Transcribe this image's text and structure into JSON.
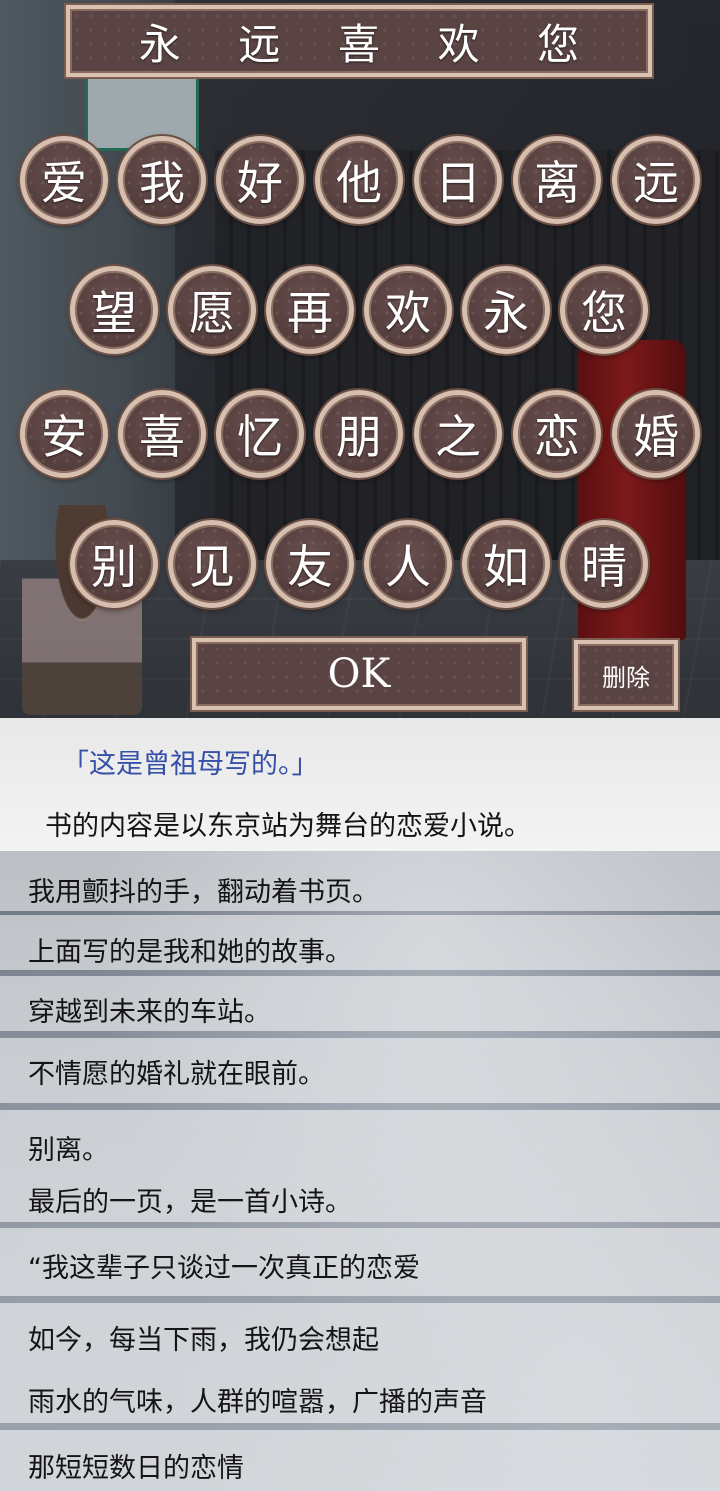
{
  "puzzle": {
    "answer": [
      "永",
      "远",
      "喜",
      "欢",
      "您"
    ],
    "rows": [
      [
        "爱",
        "我",
        "好",
        "他",
        "日",
        "离",
        "远"
      ],
      [
        "望",
        "愿",
        "再",
        "欢",
        "永",
        "您"
      ],
      [
        "安",
        "喜",
        "忆",
        "朋",
        "之",
        "恋",
        "婚"
      ],
      [
        "别",
        "见",
        "友",
        "人",
        "如",
        "晴"
      ]
    ],
    "ok_label": "OK",
    "delete_label": "删除"
  },
  "story": {
    "quote": "「这是曾祖母写的。」",
    "lines": [
      "书的内容是以东京站为舞台的恋爱小说。",
      "我用颤抖的手，翻动着书页。",
      "上面写的是我和她的故事。",
      "穿越到未来的车站。",
      "不情愿的婚礼就在眼前。",
      "别离。",
      "最后的一页，是一首小诗。",
      "“我这辈子只谈过一次真正的恋爱",
      "如今，每当下雨，我仍会想起",
      "雨水的气味，人群的喧嚣，广播的声音",
      "那短短数日的恋情"
    ]
  }
}
